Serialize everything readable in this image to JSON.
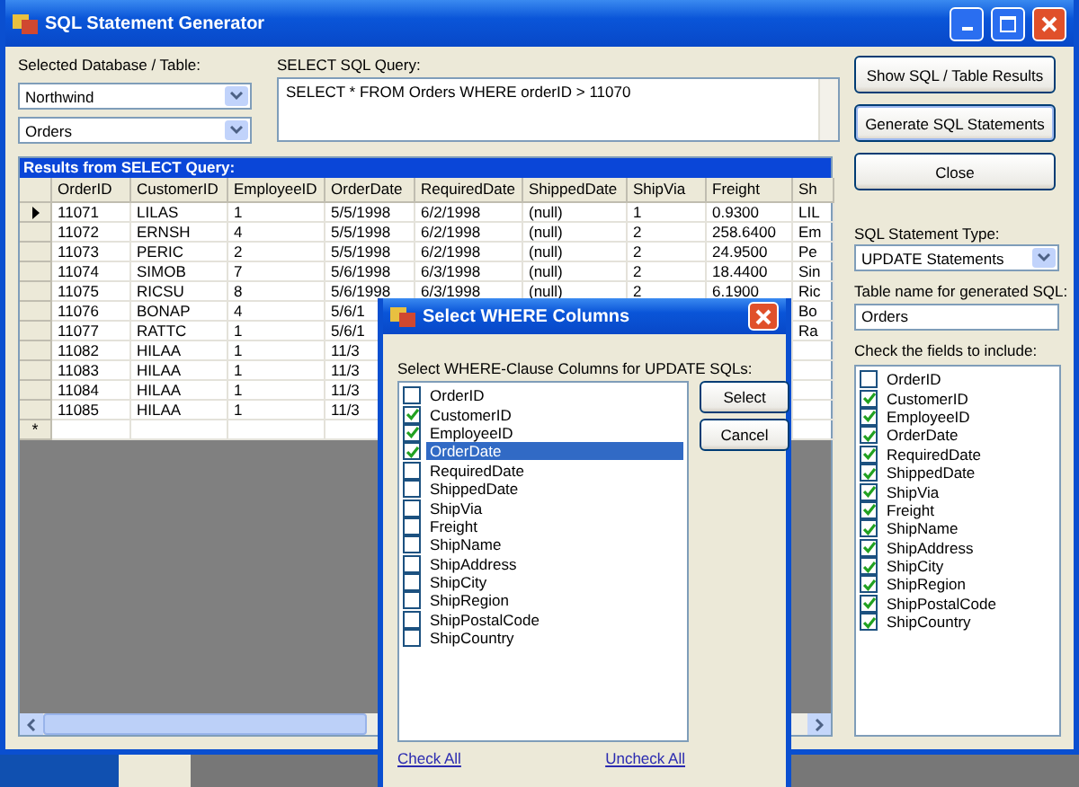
{
  "window": {
    "title": "SQL Statement Generator"
  },
  "database_table": {
    "label": "Selected Database / Table:",
    "database": "Northwind",
    "table": "Orders"
  },
  "query": {
    "label": "SELECT SQL Query:",
    "value": "SELECT * FROM Orders WHERE orderID > 11070"
  },
  "buttons": [
    "Show SQL / Table Results",
    "Generate SQL Statements",
    "Close"
  ],
  "results": {
    "title": "Results from SELECT Query:",
    "columns": [
      "OrderID",
      "CustomerID",
      "EmployeeID",
      "OrderDate",
      "RequiredDate",
      "ShippedDate",
      "ShipVia",
      "Freight",
      "Sh"
    ],
    "rows": [
      {
        "current": true,
        "cells": [
          "11071",
          "LILAS",
          "1",
          "5/5/1998",
          "6/2/1998",
          "(null)",
          "1",
          "0.9300",
          "LIL"
        ]
      },
      {
        "current": false,
        "cells": [
          "11072",
          "ERNSH",
          "4",
          "5/5/1998",
          "6/2/1998",
          "(null)",
          "2",
          "258.6400",
          "Em"
        ]
      },
      {
        "current": false,
        "cells": [
          "11073",
          "PERIC",
          "2",
          "5/5/1998",
          "6/2/1998",
          "(null)",
          "2",
          "24.9500",
          "Pe"
        ]
      },
      {
        "current": false,
        "cells": [
          "11074",
          "SIMOB",
          "7",
          "5/6/1998",
          "6/3/1998",
          "(null)",
          "2",
          "18.4400",
          "Sin"
        ]
      },
      {
        "current": false,
        "cells": [
          "11075",
          "RICSU",
          "8",
          "5/6/1998",
          "6/3/1998",
          "(null)",
          "2",
          "6.1900",
          "Ric"
        ]
      },
      {
        "current": false,
        "cells": [
          "11076",
          "BONAP",
          "4",
          "5/6/1",
          null,
          null,
          null,
          null,
          "Bo"
        ]
      },
      {
        "current": false,
        "cells": [
          "11077",
          "RATTC",
          "1",
          "5/6/1",
          null,
          null,
          null,
          null,
          "Ra"
        ]
      },
      {
        "current": false,
        "cells": [
          "11082",
          "HILAA",
          "1",
          "11/3",
          null,
          null,
          null,
          null,
          null
        ]
      },
      {
        "current": false,
        "cells": [
          "11083",
          "HILAA",
          "1",
          "11/3",
          null,
          null,
          null,
          null,
          null
        ]
      },
      {
        "current": false,
        "cells": [
          "11084",
          "HILAA",
          "1",
          "11/3",
          null,
          null,
          null,
          null,
          null
        ]
      },
      {
        "current": false,
        "cells": [
          "11085",
          "HILAA",
          "1",
          "11/3",
          null,
          null,
          null,
          null,
          null
        ]
      }
    ],
    "new_row_marker": "*"
  },
  "statement_type": {
    "label": "SQL Statement Type:",
    "value": "UPDATE Statements"
  },
  "table_name": {
    "label": "Table name for generated SQL:",
    "value": "Orders"
  },
  "fields": {
    "label": "Check the fields to include:",
    "items": [
      {
        "name": "OrderID",
        "checked": false
      },
      {
        "name": "CustomerID",
        "checked": true
      },
      {
        "name": "EmployeeID",
        "checked": true
      },
      {
        "name": "OrderDate",
        "checked": true
      },
      {
        "name": "RequiredDate",
        "checked": true
      },
      {
        "name": "ShippedDate",
        "checked": true
      },
      {
        "name": "ShipVia",
        "checked": true
      },
      {
        "name": "Freight",
        "checked": true
      },
      {
        "name": "ShipName",
        "checked": true
      },
      {
        "name": "ShipAddress",
        "checked": true
      },
      {
        "name": "ShipCity",
        "checked": true
      },
      {
        "name": "ShipRegion",
        "checked": true
      },
      {
        "name": "ShipPostalCode",
        "checked": true
      },
      {
        "name": "ShipCountry",
        "checked": true
      }
    ]
  },
  "dialog": {
    "title": "Select WHERE Columns",
    "label": "Select WHERE-Clause Columns for UPDATE SQLs:",
    "items": [
      {
        "name": "OrderID",
        "checked": false,
        "selected": false
      },
      {
        "name": "CustomerID",
        "checked": true,
        "selected": false
      },
      {
        "name": "EmployeeID",
        "checked": true,
        "selected": false
      },
      {
        "name": "OrderDate",
        "checked": true,
        "selected": true
      },
      {
        "name": "RequiredDate",
        "checked": false,
        "selected": false
      },
      {
        "name": "ShippedDate",
        "checked": false,
        "selected": false
      },
      {
        "name": "ShipVia",
        "checked": false,
        "selected": false
      },
      {
        "name": "Freight",
        "checked": false,
        "selected": false
      },
      {
        "name": "ShipName",
        "checked": false,
        "selected": false
      },
      {
        "name": "ShipAddress",
        "checked": false,
        "selected": false
      },
      {
        "name": "ShipCity",
        "checked": false,
        "selected": false
      },
      {
        "name": "ShipRegion",
        "checked": false,
        "selected": false
      },
      {
        "name": "ShipPostalCode",
        "checked": false,
        "selected": false
      },
      {
        "name": "ShipCountry",
        "checked": false,
        "selected": false
      }
    ],
    "buttons": [
      "Select",
      "Cancel"
    ],
    "links": [
      "Check All",
      "Uncheck All"
    ]
  }
}
